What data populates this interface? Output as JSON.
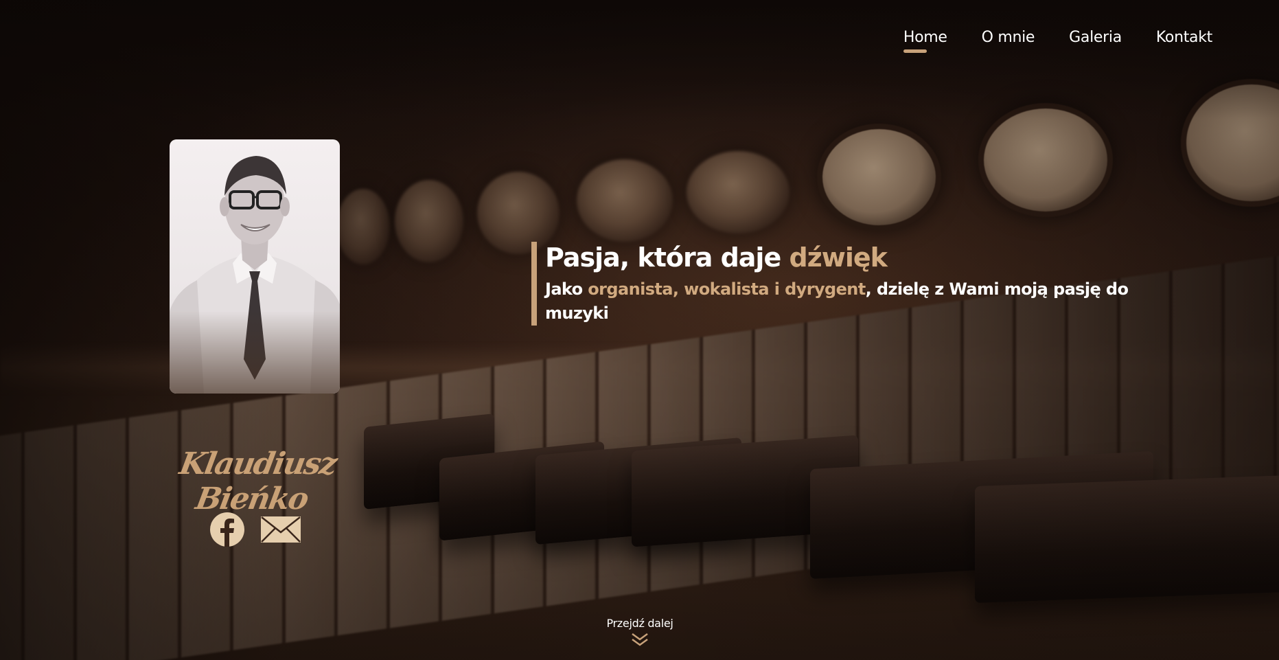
{
  "nav": {
    "items": [
      {
        "label": "Home",
        "active": true
      },
      {
        "label": "O mnie",
        "active": false
      },
      {
        "label": "Galeria",
        "active": false
      },
      {
        "label": "Kontakt",
        "active": false
      }
    ]
  },
  "profile": {
    "name": "Klaudiusz Bieńko"
  },
  "social": {
    "icons": [
      "facebook-icon",
      "mail-icon"
    ]
  },
  "hero": {
    "headline_start": "Pasja, która daje ",
    "headline_highlight": "dźwięk",
    "sub_start": "Jako ",
    "sub_highlight": "organista, wokalista i dyrygent",
    "sub_end": ", dzielę z Wami moją pasję do muzyki"
  },
  "scroll": {
    "label": "Przejdź dalej",
    "icon": "double-chevron-down-icon"
  },
  "colors": {
    "accent": "#c8a27a",
    "text": "#ffffff",
    "background": "#1e120d"
  }
}
